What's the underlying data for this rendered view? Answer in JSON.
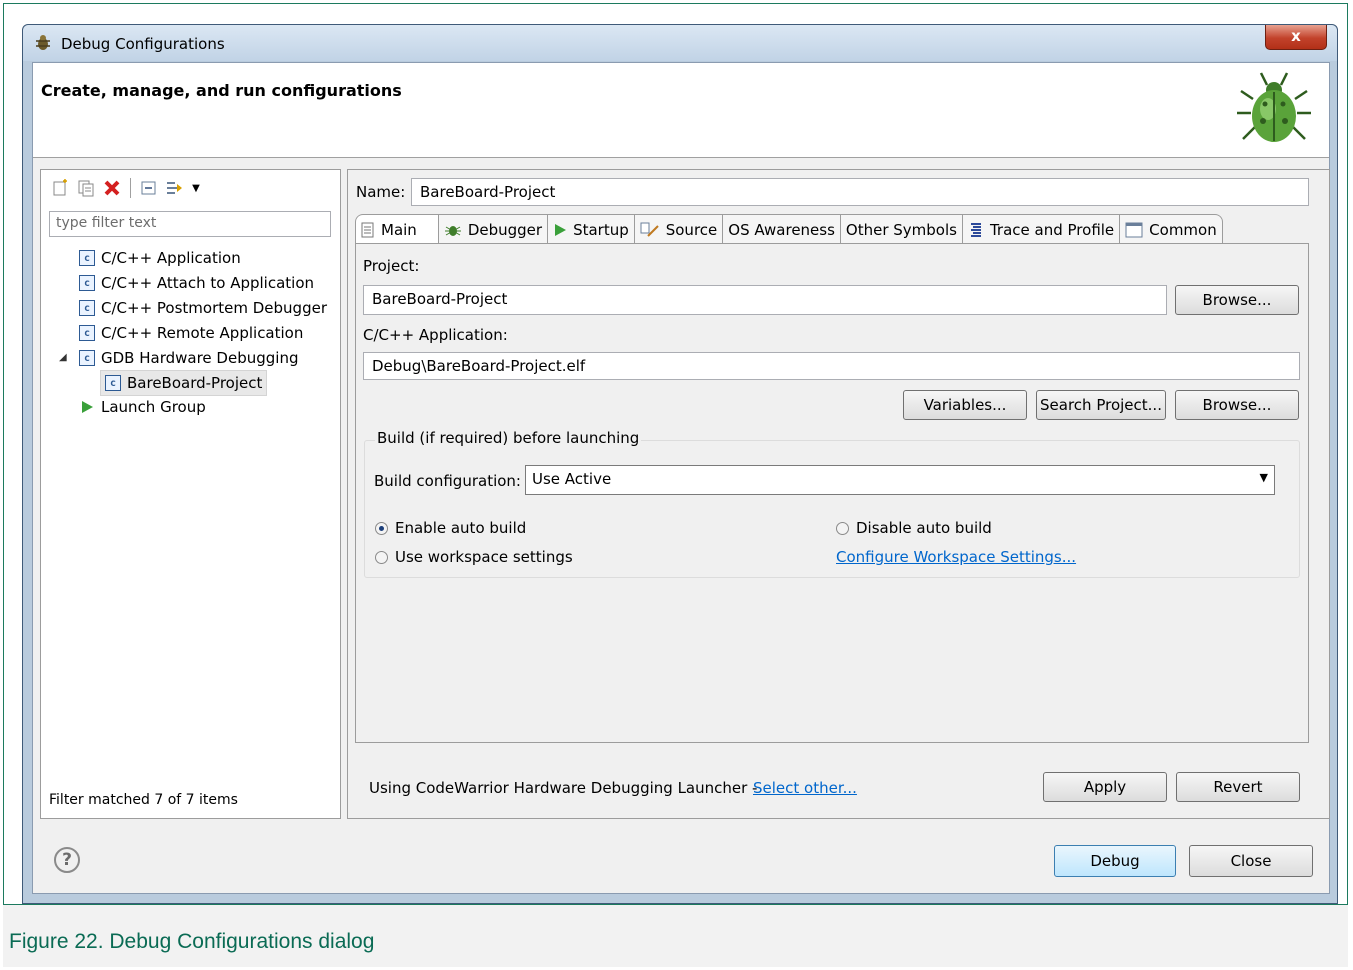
{
  "window": {
    "title": "Debug Configurations",
    "close_label": "x",
    "header_title": "Create, manage, and run configurations"
  },
  "left": {
    "filter_placeholder": "type filter text",
    "tree": [
      {
        "label": "C/C++ Application",
        "icon": "c-config-icon"
      },
      {
        "label": "C/C++ Attach to Application",
        "icon": "c-config-icon"
      },
      {
        "label": "C/C++ Postmortem Debugger",
        "icon": "c-config-icon"
      },
      {
        "label": "C/C++ Remote Application",
        "icon": "c-config-icon"
      },
      {
        "label": "GDB Hardware Debugging",
        "icon": "c-config-icon",
        "expanded": true
      },
      {
        "label": "BareBoard-Project",
        "icon": "c-config-icon",
        "selected": true
      },
      {
        "label": "Launch Group",
        "icon": "launch-group-icon"
      }
    ],
    "status": "Filter matched 7 of 7 items"
  },
  "right": {
    "name_label": "Name:",
    "name_value": "BareBoard-Project",
    "tabs": [
      "Main",
      "Debugger",
      "Startup",
      "Source",
      "OS Awareness",
      "Other Symbols",
      "Trace and Profile",
      "Common"
    ],
    "project_label": "Project:",
    "project_value": "BareBoard-Project",
    "browse_label": "Browse...",
    "app_label": "C/C++ Application:",
    "app_value": "Debug\\BareBoard-Project.elf",
    "variables_label": "Variables...",
    "search_project_label": "Search Project...",
    "build_group_title": "Build (if required) before launching",
    "build_config_label": "Build configuration:",
    "build_config_value": "Use Active",
    "enable_auto_build": "Enable auto build",
    "disable_auto_build": "Disable auto build",
    "use_workspace_settings": "Use workspace settings",
    "configure_workspace_settings": "Configure Workspace Settings...",
    "launcher_text": "Using CodeWarrior Hardware Debugging Launcher - ",
    "select_other": "Select other...",
    "apply_label": "Apply",
    "revert_label": "Revert"
  },
  "footer": {
    "debug_label": "Debug",
    "close_label": "Close"
  },
  "caption": "Figure 22.  Debug Configurations dialog",
  "colors": {
    "caption": "#0a6b54",
    "link": "#0066cc",
    "close_button": "#c2422b"
  }
}
